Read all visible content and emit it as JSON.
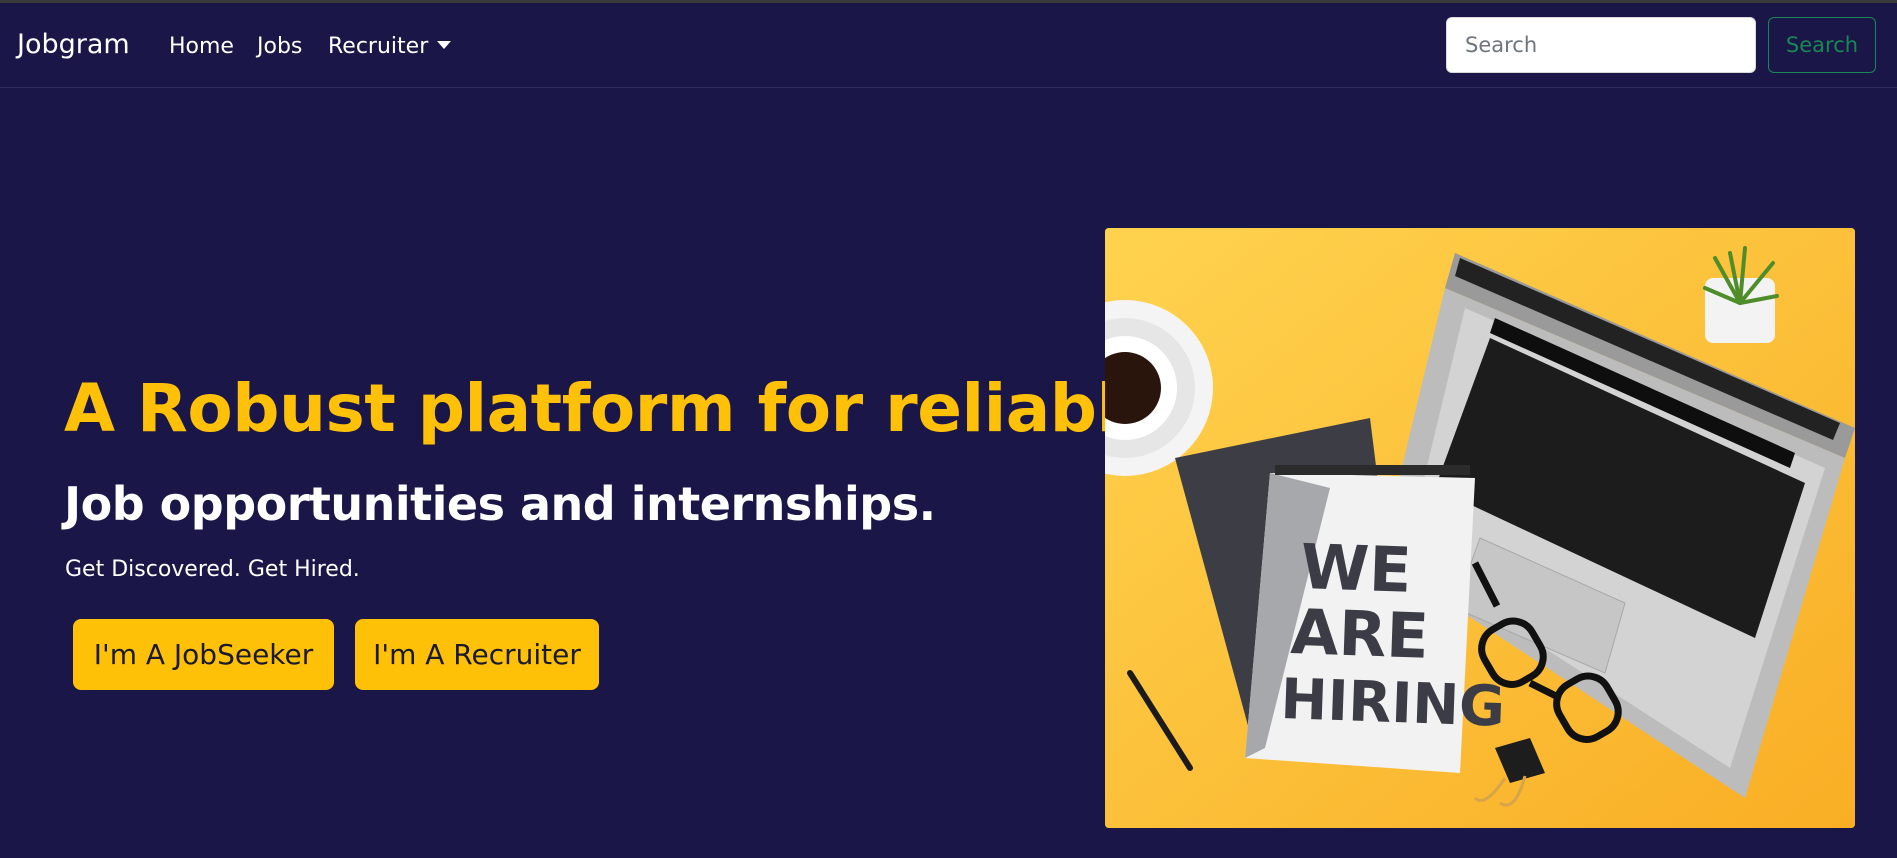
{
  "navbar": {
    "brand": "Jobgram",
    "links": [
      {
        "label": "Home"
      },
      {
        "label": "Jobs"
      },
      {
        "label": "Recruiter"
      }
    ],
    "search": {
      "placeholder": "Search",
      "button_label": "Search"
    }
  },
  "hero": {
    "title": "A Robust platform for reliable",
    "subtitle": "Job opportunities and internships.",
    "tagline": "Get Discovered. Get Hired.",
    "buttons": {
      "jobseeker": "I'm A JobSeeker",
      "recruiter": "I'm A Recruiter"
    },
    "image": {
      "description_icon": "hiring-illustration",
      "notebook_text": [
        "WE",
        "ARE",
        "HIRING"
      ]
    }
  },
  "colors": {
    "background": "#1a1748",
    "accent": "#ffc107",
    "search_button": "#198754",
    "image_background": "#fdbe36"
  }
}
